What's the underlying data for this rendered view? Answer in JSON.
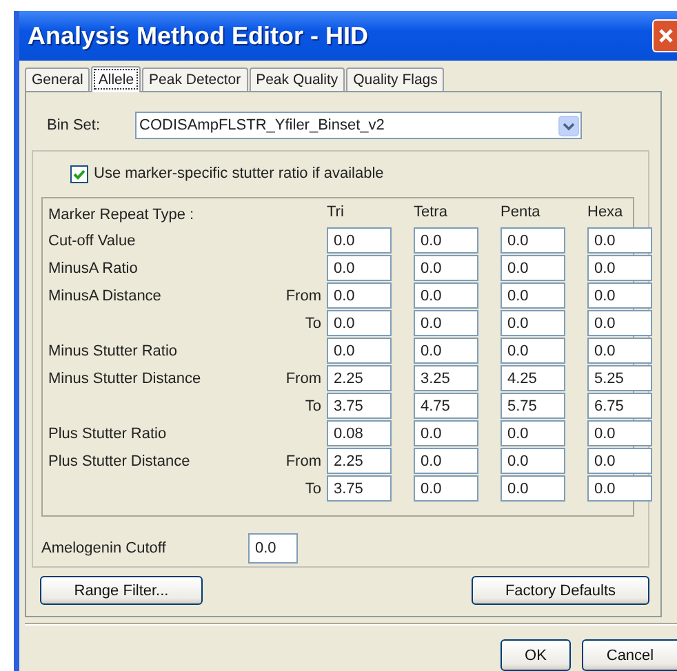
{
  "window": {
    "title": "Analysis Method Editor - HID"
  },
  "tabs": [
    {
      "label": "General",
      "selected": false
    },
    {
      "label": "Allele",
      "selected": true
    },
    {
      "label": "Peak Detector",
      "selected": false
    },
    {
      "label": "Peak Quality",
      "selected": false
    },
    {
      "label": "Quality Flags",
      "selected": false
    }
  ],
  "bin_set": {
    "label": "Bin Set:",
    "value": "CODISAmpFLSTR_Yfiler_Binset_v2"
  },
  "stutter_checkbox": {
    "label": "Use marker-specific stutter ratio if available",
    "checked": true
  },
  "table": {
    "header_label": "Marker Repeat Type :",
    "columns": [
      "Tri",
      "Tetra",
      "Penta",
      "Hexa"
    ],
    "rows": [
      {
        "label": "Cut-off Value",
        "values": [
          "0.0",
          "0.0",
          "0.0",
          "0.0"
        ]
      },
      {
        "label": "MinusA Ratio",
        "values": [
          "0.0",
          "0.0",
          "0.0",
          "0.0"
        ]
      },
      {
        "label": "MinusA Distance",
        "sub": "From",
        "values": [
          "0.0",
          "0.0",
          "0.0",
          "0.0"
        ]
      },
      {
        "sub": "To",
        "values": [
          "0.0",
          "0.0",
          "0.0",
          "0.0"
        ]
      },
      {
        "label": "Minus Stutter Ratio",
        "values": [
          "0.0",
          "0.0",
          "0.0",
          "0.0"
        ]
      },
      {
        "label": "Minus Stutter Distance",
        "sub": "From",
        "values": [
          "2.25",
          "3.25",
          "4.25",
          "5.25"
        ]
      },
      {
        "sub": "To",
        "values": [
          "3.75",
          "4.75",
          "5.75",
          "6.75"
        ]
      },
      {
        "label": "Plus Stutter Ratio",
        "values": [
          "0.08",
          "0.0",
          "0.0",
          "0.0"
        ]
      },
      {
        "label": "Plus Stutter Distance",
        "sub": "From",
        "values": [
          "2.25",
          "0.0",
          "0.0",
          "0.0"
        ]
      },
      {
        "sub": "To",
        "values": [
          "3.75",
          "0.0",
          "0.0",
          "0.0"
        ]
      }
    ]
  },
  "amelogenin": {
    "label": "Amelogenin Cutoff",
    "value": "0.0"
  },
  "panel_buttons": [
    "Range Filter...",
    "Factory Defaults"
  ],
  "dialog_buttons": [
    "OK",
    "Cancel"
  ]
}
